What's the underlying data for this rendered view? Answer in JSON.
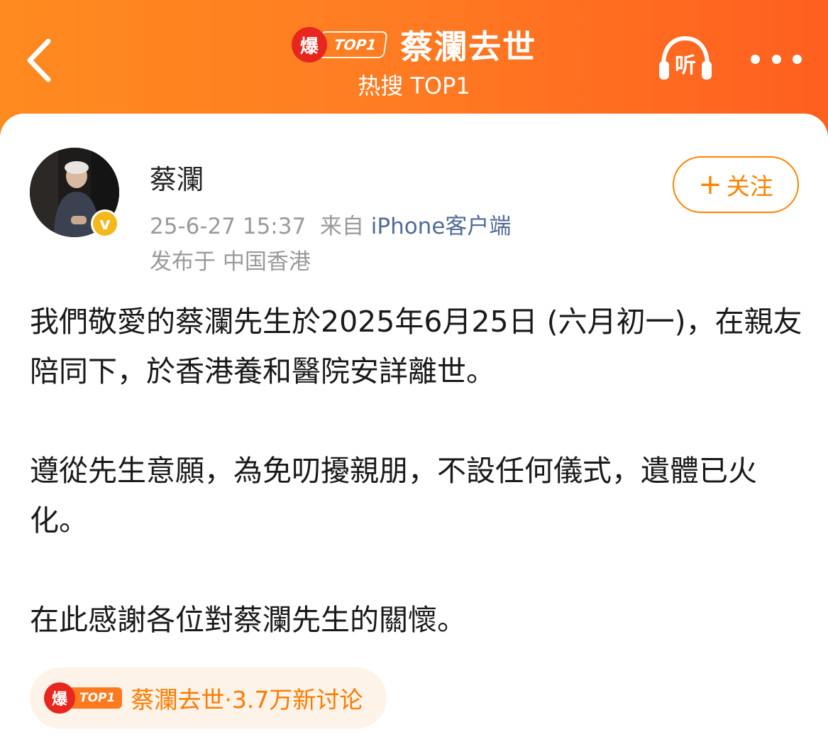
{
  "header": {
    "hot_badge_char": "爆",
    "hot_badge_tag": "TOP1",
    "title": "蔡瀾去世",
    "subtitle": "热搜 TOP1",
    "listen_label": "听"
  },
  "post": {
    "username": "蔡瀾",
    "timestamp": "25-6-27 15:37",
    "source_prefix": "来自",
    "source": "iPhone客户端",
    "location": "发布于 中国香港",
    "follow_label": "关注",
    "paragraphs": [
      "我們敬愛的蔡瀾先生於2025年6月25日 (六月初一)，在親友陪同下，於香港養和醫院安詳離世。",
      "遵從先生意願，為免叨擾親朋，不設任何儀式，遺體已火化。",
      "在此感謝各位對蔡瀾先生的關懷。"
    ]
  },
  "topic_chip": {
    "badge_char": "爆",
    "badge_tag": "TOP1",
    "text": "蔡瀾去世·3.7万新讨论"
  },
  "colors": {
    "header_gradient_start": "#ff8a1f",
    "header_gradient_end": "#ff5f1f",
    "accent_orange": "#ff8200",
    "hot_red": "#e8261e",
    "verified_gold": "#f5b81b",
    "source_blue": "#516a96"
  },
  "icons": {
    "back": "chevron-left-icon",
    "listen": "headphones-icon",
    "more": "more-dots-icon",
    "verified": "verified-v-icon"
  }
}
